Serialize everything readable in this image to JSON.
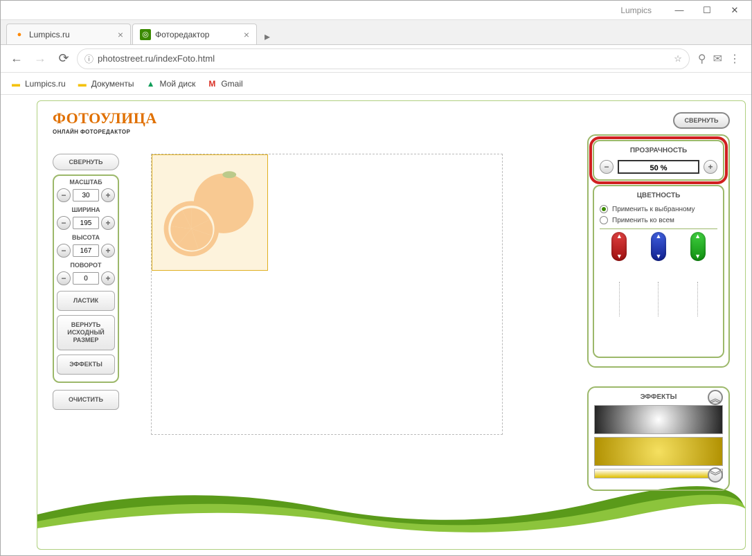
{
  "window": {
    "app_name": "Lumpics"
  },
  "tabs": [
    {
      "title": "Lumpics.ru",
      "favicon_bg": "#ff8800",
      "favicon_glyph": "●"
    },
    {
      "title": "Фоторедактор",
      "favicon_bg": "#3a8a00",
      "favicon_glyph": "◎"
    }
  ],
  "url": "photostreet.ru/indexFoto.html",
  "bookmarks": [
    {
      "label": "Lumpics.ru",
      "icon_color": "#f4c20d",
      "glyph": "▭"
    },
    {
      "label": "Документы",
      "icon_color": "#f4c20d",
      "glyph": "▭"
    },
    {
      "label": "Мой диск",
      "icon_color": "#0f9d58",
      "glyph": "▲"
    },
    {
      "label": "Gmail",
      "icon_color": "#d93025",
      "glyph": "M"
    }
  ],
  "logo": {
    "main": "ФОТОУЛИЦА",
    "sub": "ОНЛАЙН ФОТОРЕДАКТОР"
  },
  "left": {
    "collapse": "СВЕРНУТЬ",
    "items": [
      {
        "label": "МАСШТАБ",
        "value": "30"
      },
      {
        "label": "ШИРИНА",
        "value": "195"
      },
      {
        "label": "ВЫСОТА",
        "value": "167"
      },
      {
        "label": "ПОВОРОТ",
        "value": "0"
      }
    ],
    "eraser": "ЛАСТИК",
    "restore": "ВЕРНУТЬ ИСХОДНЫЙ РАЗМЕР",
    "effects": "ЭФФЕКТЫ",
    "clear": "ОЧИСТИТЬ"
  },
  "right": {
    "collapse": "СВЕРНУТЬ",
    "transparency_label": "ПРОЗРАЧНОСТЬ",
    "transparency_value": "50 %",
    "color_label": "ЦВЕТНОСТЬ",
    "apply_selected": "Применить к выбранному",
    "apply_all": "Применить ко всем",
    "effects_label": "ЭФФЕКТЫ"
  }
}
